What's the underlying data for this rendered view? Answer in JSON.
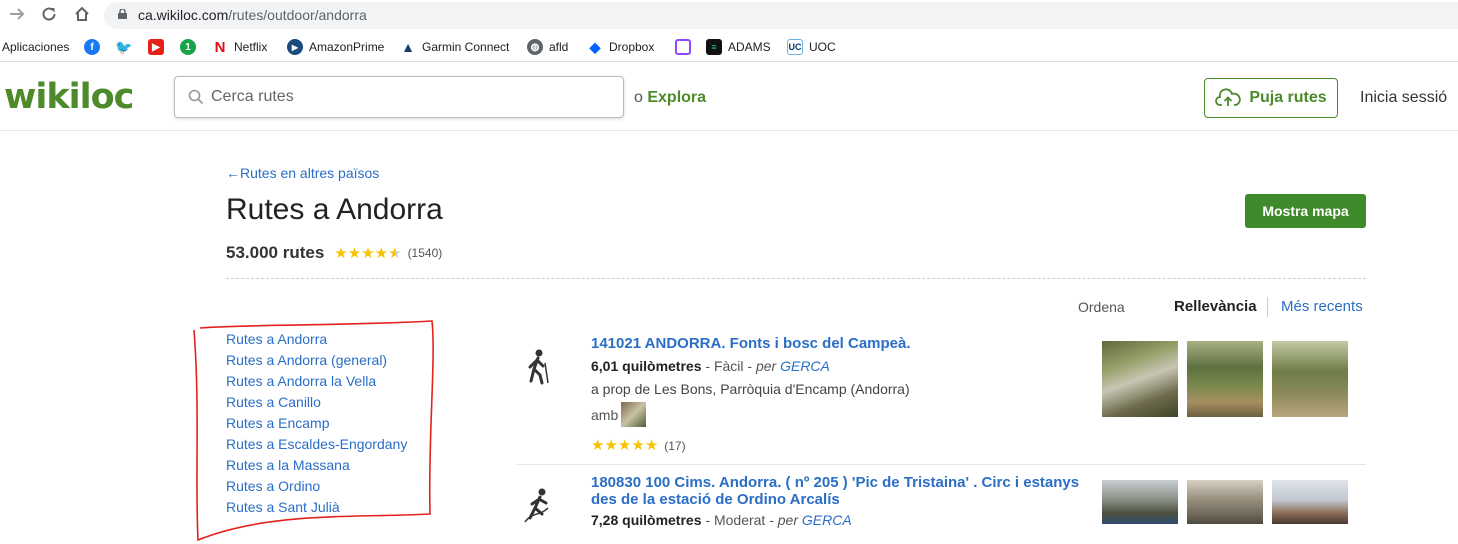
{
  "browser": {
    "url_host": "ca.wikiloc.com",
    "url_path": "/rutes/outdoor/andorra",
    "bookmarks": [
      {
        "label": "Aplicaciones",
        "icon": "apps-icon"
      },
      {
        "label": "",
        "icon": "facebook-icon"
      },
      {
        "label": "",
        "icon": "twitter-icon"
      },
      {
        "label": "",
        "icon": "youtube-icon"
      },
      {
        "label": "",
        "icon": "number-one-icon"
      },
      {
        "label": "Netflix",
        "icon": "netflix-icon"
      },
      {
        "label": "AmazonPrime",
        "icon": "play-icon"
      },
      {
        "label": "Garmin Connect",
        "icon": "garmin-icon"
      },
      {
        "label": "afld",
        "icon": "globe-icon"
      },
      {
        "label": "Dropbox",
        "icon": "dropbox-icon"
      },
      {
        "label": "",
        "icon": "twitch-icon"
      },
      {
        "label": "ADAMS",
        "icon": "adams-icon"
      },
      {
        "label": "UOC",
        "icon": "uoc-icon"
      }
    ]
  },
  "header": {
    "logo": "wikiloc",
    "search_placeholder": "Cerca rutes",
    "explore_prefix": "o",
    "explore_link": "Explora",
    "upload": "Puja rutes",
    "login": "Inicia sessió",
    "brand_color": "#4c8a2a"
  },
  "main": {
    "back_link": "←Rutes en altres països",
    "title": "Rutes a Andorra",
    "show_map": "Mostra mapa",
    "count": "53.000 rutes",
    "rating": 4.5,
    "rating_count": "(1540)",
    "sort": {
      "label": "Ordena",
      "active": "Rellevància",
      "other": "Més recents"
    }
  },
  "locations": [
    "Rutes a Andorra",
    "Rutes a Andorra (general)",
    "Rutes a Andorra la Vella",
    "Rutes a Canillo",
    "Rutes a Encamp",
    "Rutes a Escaldes-Engordany",
    "Rutes a la Massana",
    "Rutes a Ordino",
    "Rutes a Sant Julià"
  ],
  "trails": [
    {
      "title": "141021 ANDORRA. Fonts i bosc del Campeà.",
      "distance": "6,01 quilòmetres",
      "difficulty": "Fàcil",
      "by_prefix": "per",
      "author": "GERCA",
      "near": "a prop de Les Bons, Parròquia d'Encamp (Andorra)",
      "with_label": "amb",
      "rating": 5,
      "rating_count": "(17)",
      "icon": "hiking-icon"
    },
    {
      "title": "180830 100 Cims. Andorra. ( nº 205 ) 'Pic de Tristaina' . Circ i estanys des de la estació de Ordino Arcalís",
      "distance": "7,28 quilòmetres",
      "difficulty": "Moderat",
      "by_prefix": "per",
      "author": "GERCA",
      "icon": "mountaineering-icon"
    }
  ]
}
